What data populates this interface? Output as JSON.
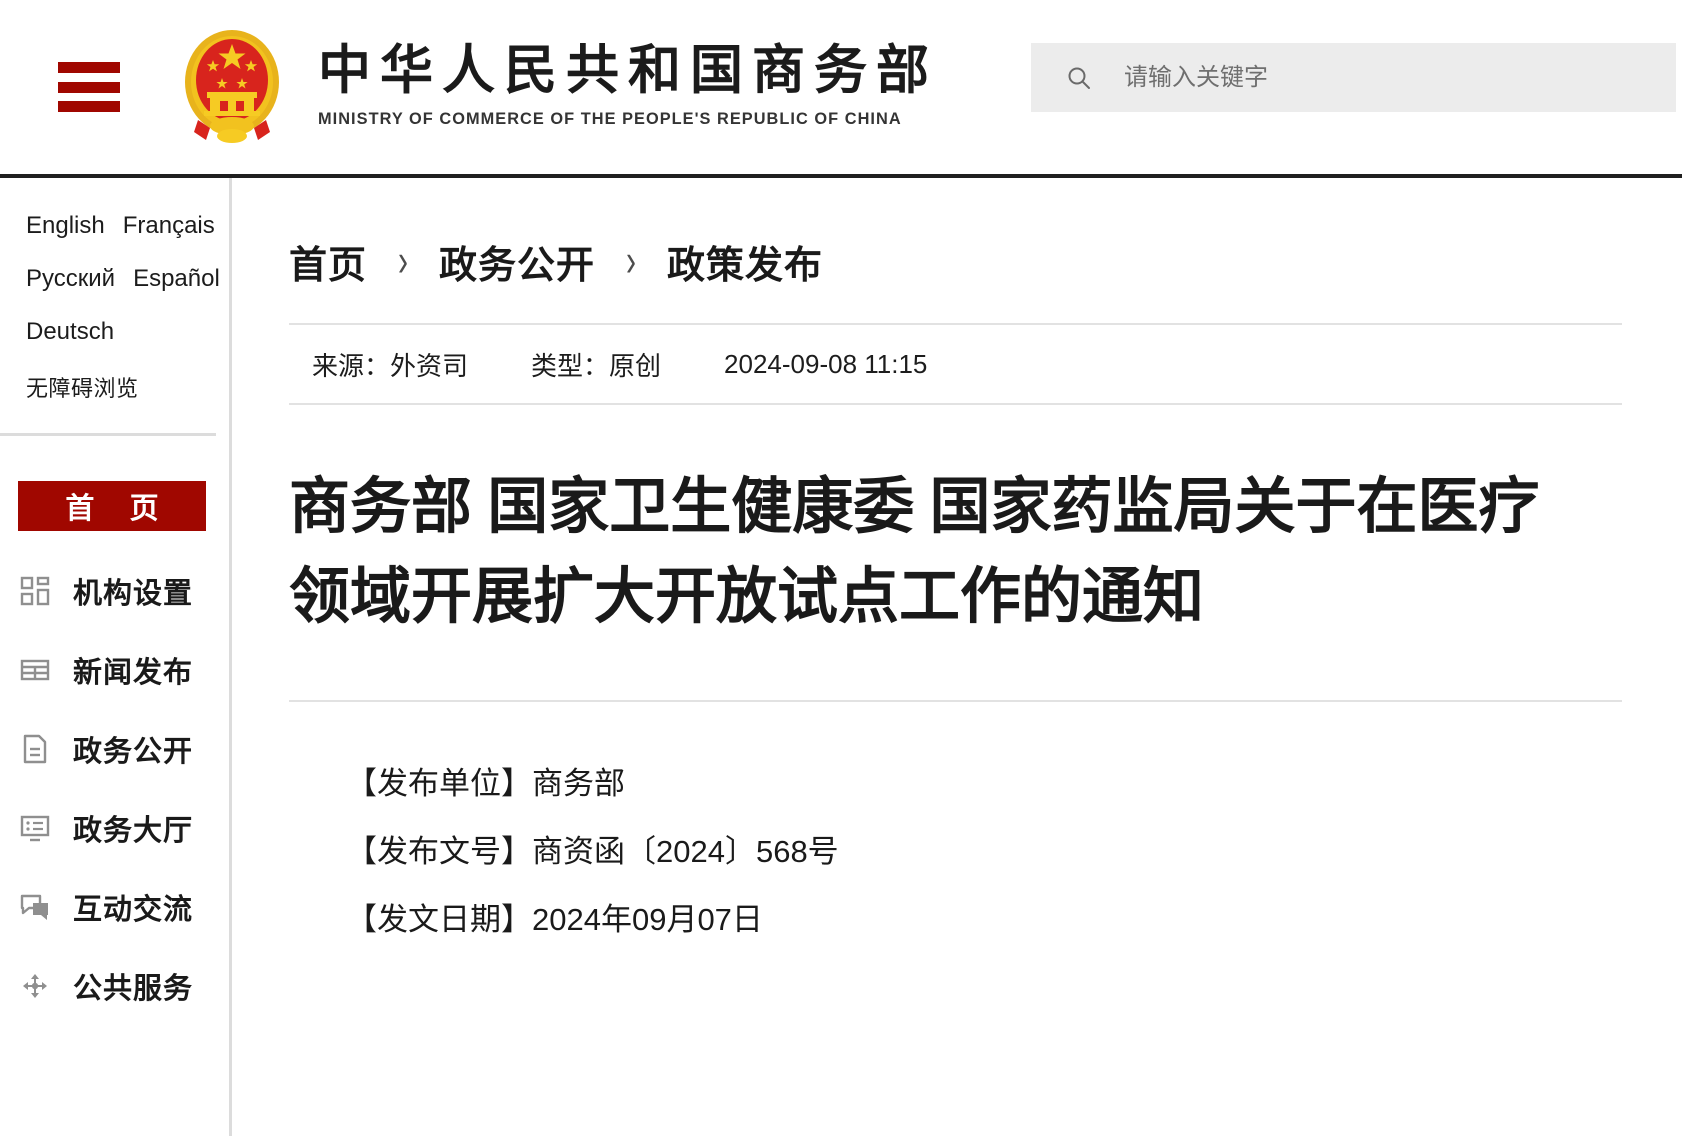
{
  "header": {
    "menu_icon": "hamburger-icon",
    "emblem_icon": "china-national-emblem",
    "brand_cn": "中华人民共和国商务部",
    "brand_en": "MINISTRY OF COMMERCE OF THE PEOPLE'S REPUBLIC OF CHINA",
    "search": {
      "icon": "search-icon",
      "placeholder": "请输入关键字",
      "value": ""
    },
    "accent_color": "#a00700"
  },
  "sidebar": {
    "languages": [
      {
        "label": "English"
      },
      {
        "label": "Français"
      },
      {
        "label": "Русский"
      },
      {
        "label": "Español"
      },
      {
        "label": "Deutsch"
      },
      {
        "label": "无障碍浏览"
      }
    ],
    "nav": {
      "home_label": "首 页",
      "home_active": true,
      "items": [
        {
          "label": "机构设置",
          "icon": "grid-blocks-icon"
        },
        {
          "label": "新闻发布",
          "icon": "table-icon"
        },
        {
          "label": "政务公开",
          "icon": "document-icon"
        },
        {
          "label": "政务大厅",
          "icon": "monitor-list-icon"
        },
        {
          "label": "互动交流",
          "icon": "chat-bubbles-icon"
        },
        {
          "label": "公共服务",
          "icon": "share-nodes-icon"
        }
      ]
    }
  },
  "main": {
    "breadcrumb": {
      "separator": "›",
      "items": [
        {
          "label": "首页"
        },
        {
          "label": "政务公开"
        },
        {
          "label": "政策发布"
        }
      ]
    },
    "meta": [
      {
        "label": "来源：外资司"
      },
      {
        "label": "类型：原创"
      },
      {
        "label": "2024-09-08 11:15"
      }
    ],
    "title": "商务部 国家卫生健康委 国家药监局关于在医疗领域开展扩大开放试点工作的通知",
    "body_lines": [
      {
        "text": "【发布单位】商务部"
      },
      {
        "text": "【发布文号】商资函〔2024〕568号"
      },
      {
        "text": "【发文日期】2024年09月07日"
      }
    ]
  }
}
